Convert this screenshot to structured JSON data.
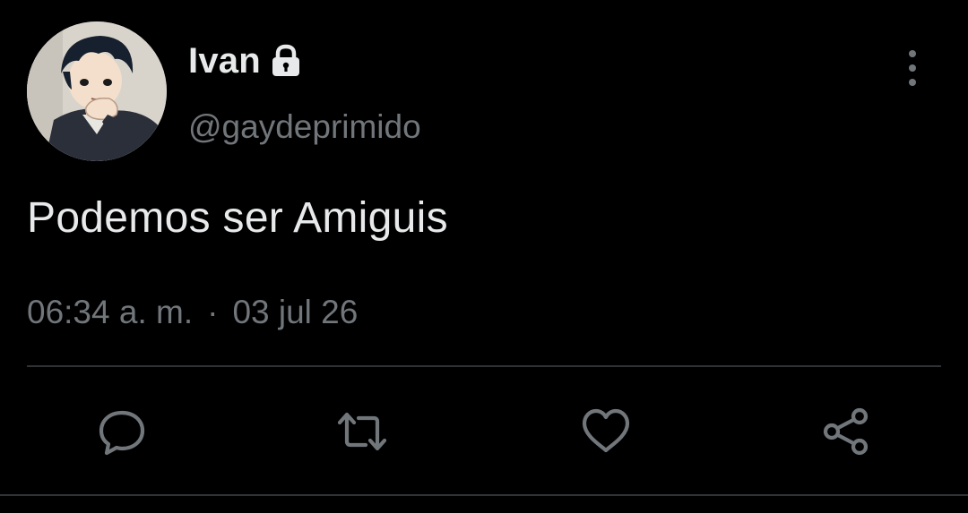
{
  "author": {
    "display_name": "Ivan",
    "handle": "@gaydeprimido",
    "protected": true
  },
  "tweet": {
    "text": "Podemos ser Amiguis",
    "time": "06:34 a. m.",
    "separator": "·",
    "date": "03 jul 26"
  },
  "actions": {
    "reply_icon": "reply-icon",
    "retweet_icon": "retweet-icon",
    "like_icon": "like-icon",
    "share_icon": "share-icon"
  },
  "colors": {
    "background": "#000000",
    "primary_text": "#e7e9ea",
    "secondary_text": "#71767b",
    "divider": "#2f3336"
  }
}
